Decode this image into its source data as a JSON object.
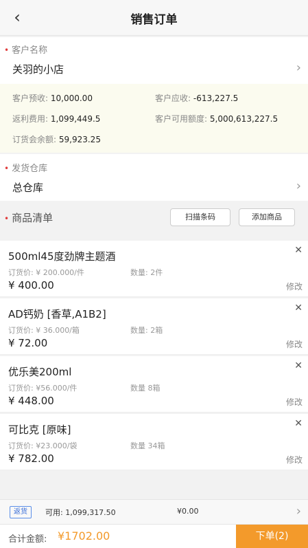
{
  "header": {
    "title": "销售订单",
    "back_icon": "back-chevron-icon"
  },
  "customer": {
    "label": "客户名称",
    "value": "关羽的小店"
  },
  "info": {
    "prepaid_label": "客户预收:",
    "prepaid_value": "10,000.00",
    "receivable_label": "客户应收:",
    "receivable_value": "-613,227.5",
    "rebate_label": "返利费用:",
    "rebate_value": "1,099,449.5",
    "credit_label": "客户可用额度:",
    "credit_value": "5,000,613,227.5",
    "balance_label": "订货会余额:",
    "balance_value": "59,923.25"
  },
  "warehouse": {
    "label": "发货仓库",
    "value": "总仓库"
  },
  "goods": {
    "label": "商品清单",
    "scan_label": "扫描条码",
    "add_label": "添加商品"
  },
  "items": [
    {
      "name": "500ml45度劲牌主题酒",
      "price": "订货价: ¥ 200.000/件",
      "qty": "数量: 2件",
      "total": "¥ 400.00",
      "edit": "修改"
    },
    {
      "name": "AD钙奶 [香草,A1B2]",
      "price": "订货价: ¥ 36.000/箱",
      "qty": "数量: 2箱",
      "total": "¥ 72.00",
      "edit": "修改"
    },
    {
      "name": "优乐美200ml",
      "price": "订货价: ¥56.000/件",
      "qty": "数量  8箱",
      "total": "¥ 448.00",
      "edit": "修改"
    },
    {
      "name": "可比克 [原味]",
      "price": "订货价: ¥23.000/袋",
      "qty": "数量  34箱",
      "total": "¥ 782.00",
      "edit": "修改"
    }
  ],
  "bottom": {
    "tag": "返货",
    "available": "可用: 1,099,317.50",
    "amount": "¥0.00"
  },
  "footer": {
    "total_label": "合计金额:",
    "total_value": "¥1702.00",
    "submit_label": "下单(2)"
  },
  "colors": {
    "accent": "#f39a2b",
    "required": "#e03b3b",
    "info_bg": "#fbfbef"
  }
}
